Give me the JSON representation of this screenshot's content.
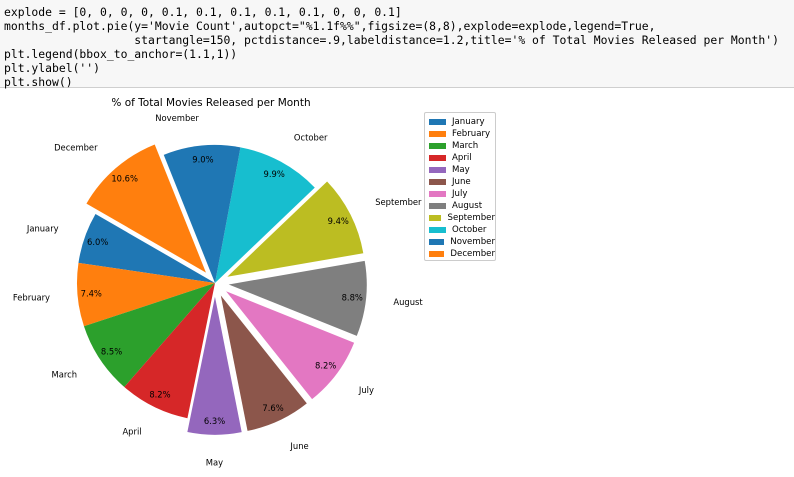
{
  "code": {
    "lines": [
      "explode = [0, 0, 0, 0, 0.1, 0.1, 0.1, 0.1, 0.1, 0, 0, 0.1]",
      "months_df.plot.pie(y='Movie Count',autopct=\"%1.1f%%\",figsize=(8,8),explode=explode,legend=True,",
      "                   startangle=150, pctdistance=.9,labeldistance=1.2,title='% of Total Movies Released per Month')",
      "plt.legend(bbox_to_anchor=(1.1,1))",
      "plt.ylabel('')",
      "plt.show()"
    ]
  },
  "chart_data": {
    "type": "pie",
    "title": "% of Total Movies Released per Month",
    "categories": [
      "January",
      "February",
      "March",
      "April",
      "May",
      "June",
      "July",
      "August",
      "September",
      "October",
      "November",
      "December"
    ],
    "values": [
      6.0,
      7.4,
      8.5,
      8.2,
      6.3,
      7.6,
      8.2,
      8.8,
      9.4,
      9.9,
      9.0,
      10.6
    ],
    "labels": [
      "6.0%",
      "7.4%",
      "8.5%",
      "8.2%",
      "6.3%",
      "7.6%",
      "8.2%",
      "8.8%",
      "9.4%",
      "9.9%",
      "9.0%",
      "10.6%"
    ],
    "explode": [
      0,
      0,
      0,
      0,
      0.1,
      0.1,
      0.1,
      0.1,
      0.1,
      0,
      0,
      0.1
    ],
    "startangle": 150,
    "colors": [
      "#1f77b4",
      "#ff7f0e",
      "#2ca02c",
      "#d62728",
      "#9467bd",
      "#8c564b",
      "#e377c2",
      "#7f7f7f",
      "#bcbd22",
      "#17becf",
      "#1f77b4",
      "#ff7f0e"
    ],
    "legend_placement": "right"
  }
}
